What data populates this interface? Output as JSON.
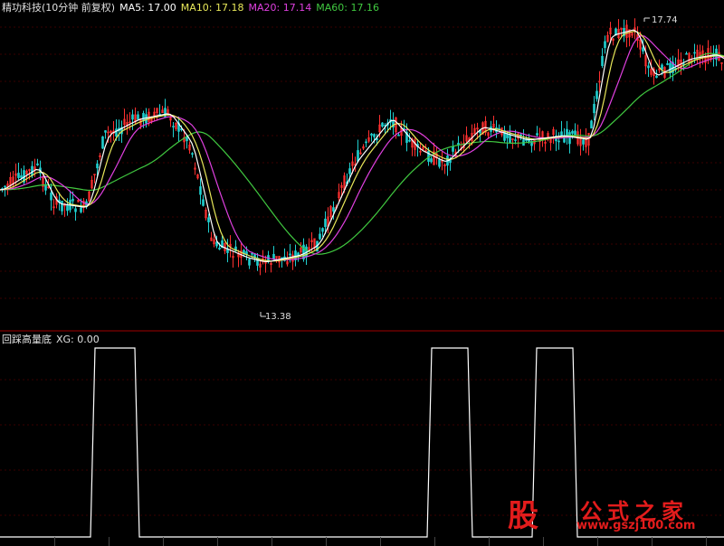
{
  "header": {
    "title": "精功科技(10分钟 前复权)",
    "ma5": {
      "label": "MA5: 17.00",
      "color": "#ffffff"
    },
    "ma10": {
      "label": "MA10: 17.18",
      "color": "#e8e85a"
    },
    "ma20": {
      "label": "MA20: 17.14",
      "color": "#e040e0"
    },
    "ma60": {
      "label": "MA60: 17.16",
      "color": "#40c840"
    }
  },
  "indicator": {
    "title": "回踩高量底",
    "xg_label": "XG: 0.00",
    "pulses": [
      [
        0.125,
        0.19
      ],
      [
        0.59,
        0.65
      ],
      [
        0.735,
        0.795
      ]
    ]
  },
  "labels": {
    "high": "17.74",
    "low": "13.38"
  },
  "logo": {
    "mark": "股",
    "name": "公式之家",
    "url": "www.gszj100.com"
  },
  "colors": {
    "up": "#ff3030",
    "down": "#20d0d0",
    "grid": "#3a0000",
    "frame": "#a00000"
  }
}
